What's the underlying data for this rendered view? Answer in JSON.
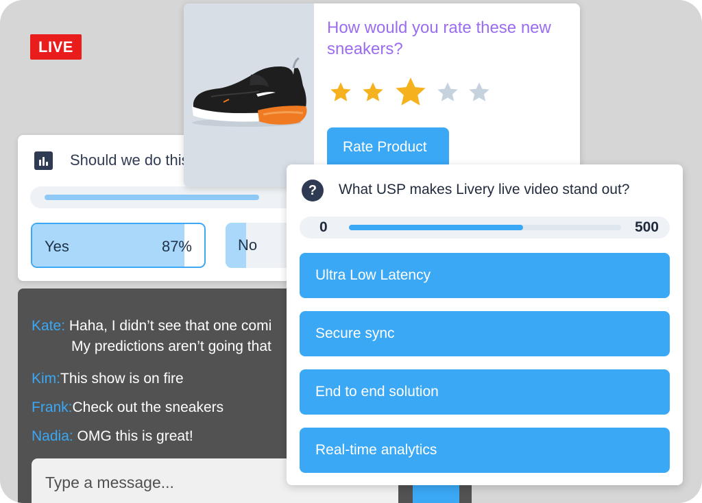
{
  "live_badge": "LIVE",
  "poll": {
    "title": "Should we do this",
    "progress": 0.87,
    "options": [
      {
        "label": "Yes",
        "percent": "87%",
        "fill": 0.87
      },
      {
        "label": "No",
        "fill": 0.13
      }
    ]
  },
  "rating": {
    "question": "How would you rate these new sneakers?",
    "stars_total": 5,
    "stars_selected": 3,
    "button_label": "Rate Product",
    "star_color": "#f5b21e",
    "star_empty_color": "#c6d2dd"
  },
  "chat": {
    "messages": [
      {
        "author": "Kate:",
        "text": "Haha, I didn’t see that one comi",
        "continuation": "My predictions aren’t going that"
      },
      {
        "author": "Kim:",
        "text": "This show is on fire"
      },
      {
        "author": "Frank:",
        "text": "Check out the sneakers"
      },
      {
        "author": "Nadia:",
        "text": "OMG this is great!"
      }
    ],
    "input_placeholder": "Type a message..."
  },
  "quiz": {
    "question": "What USP makes Livery live video stand out?",
    "timer_min": "0",
    "timer_max": "500",
    "timer_progress": 0.64,
    "options": [
      "Ultra Low Latency",
      "Secure sync",
      "End to end solution",
      "Real-time analytics"
    ]
  },
  "colors": {
    "accent": "#3aa8f5",
    "live_red": "#ea1d1d",
    "question_purple": "#9b6cf0",
    "chat_bg": "#525252"
  }
}
